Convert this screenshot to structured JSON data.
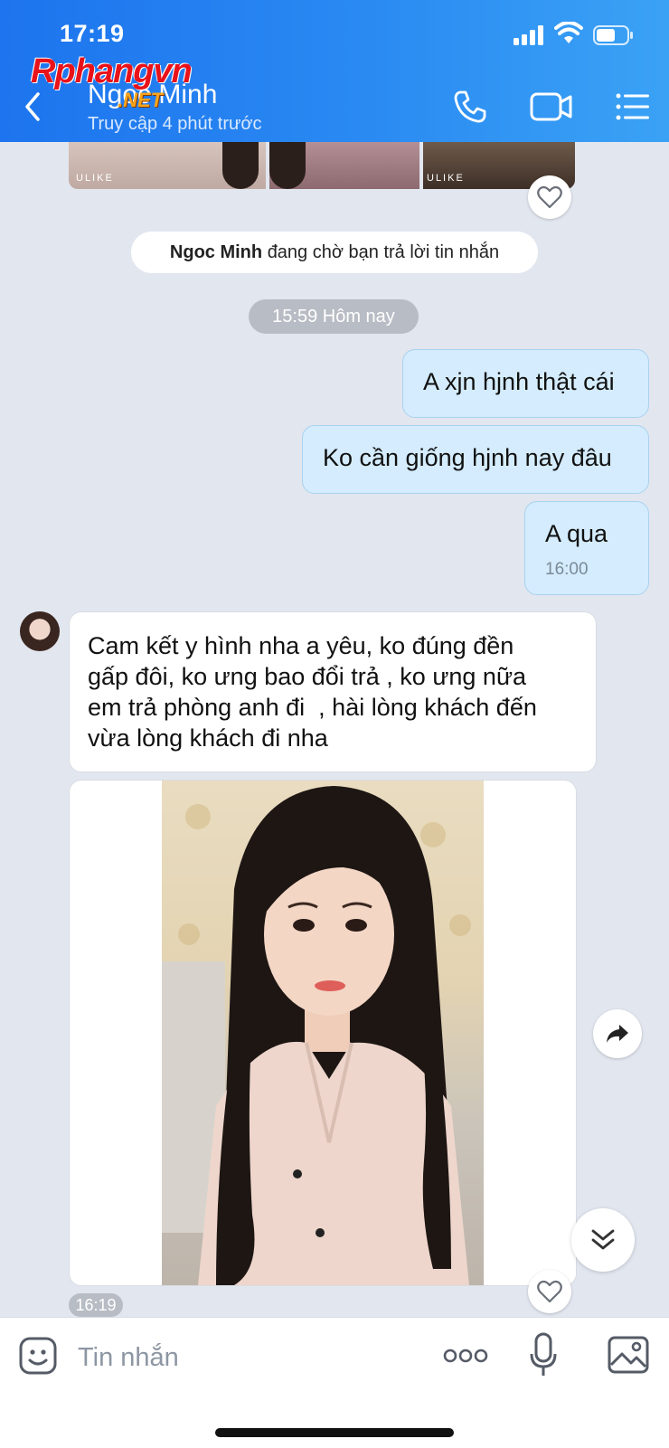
{
  "status_bar": {
    "time": "17:19"
  },
  "watermark": {
    "main": "Rphangvn",
    "sub": ".NET"
  },
  "header": {
    "contact_name": "Ngoc Minh",
    "contact_status": "Truy cập 4 phút trước",
    "icons": [
      "back-arrow-icon",
      "phone-icon",
      "video-camera-icon",
      "menu-list-icon"
    ]
  },
  "top_images": {
    "tags": [
      "ULIKE",
      "ULIKE"
    ]
  },
  "notice": {
    "name": "Ngoc Minh",
    "text": "đang chờ bạn trả lời tin nhắn"
  },
  "date_separator": "15:59 Hôm nay",
  "messages_out": [
    {
      "text": "A xjn hjnh thật cái"
    },
    {
      "text": "Ko cần giống hjnh nay đâu"
    },
    {
      "text": "A qua",
      "time": "16:00"
    }
  ],
  "message_in": {
    "lines": [
      "Cam kết y hình nha a yêu, ko đúng đền",
      "gấp đôi, ko ưng bao đổi trả , ko ưng nữa",
      "em trả phòng anh đi  , hài lòng khách đến",
      "vừa lòng khách đi nha"
    ]
  },
  "photo_message": {
    "time": "16:19"
  },
  "input_bar": {
    "placeholder": "Tin nhắn",
    "icons": [
      "sticker-icon",
      "more-dots-icon",
      "microphone-icon",
      "gallery-icon"
    ]
  },
  "colors": {
    "header_gradient_start": "#1d74ee",
    "header_gradient_end": "#3aa2f5",
    "chat_background": "#e2e6ef",
    "outgoing_bubble": "#d4ecfd",
    "incoming_bubble": "#ffffff"
  }
}
